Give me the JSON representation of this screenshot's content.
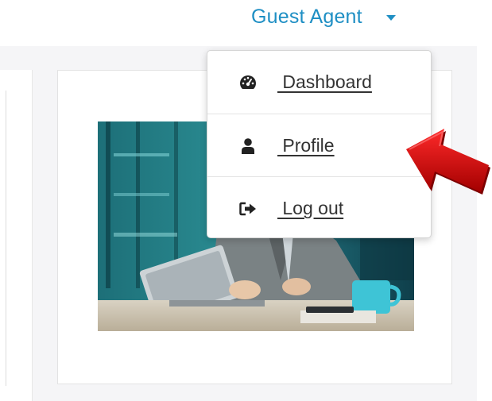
{
  "header": {
    "user_name": "Guest Agent",
    "caret_icon": "caret-down-icon",
    "accent_color": "#1f8fc4"
  },
  "user_dropdown": {
    "items": [
      {
        "label": " Dashboard",
        "icon": "dashboard-gauge-icon"
      },
      {
        "label": " Profile",
        "icon": "user-icon"
      },
      {
        "label": " Log out",
        "icon": "sign-out-icon"
      }
    ]
  },
  "annotation": {
    "icon": "red-arrow-pointing-left",
    "color": "#cc0000"
  },
  "image": {
    "subject": "businessperson working on laptop in office"
  }
}
